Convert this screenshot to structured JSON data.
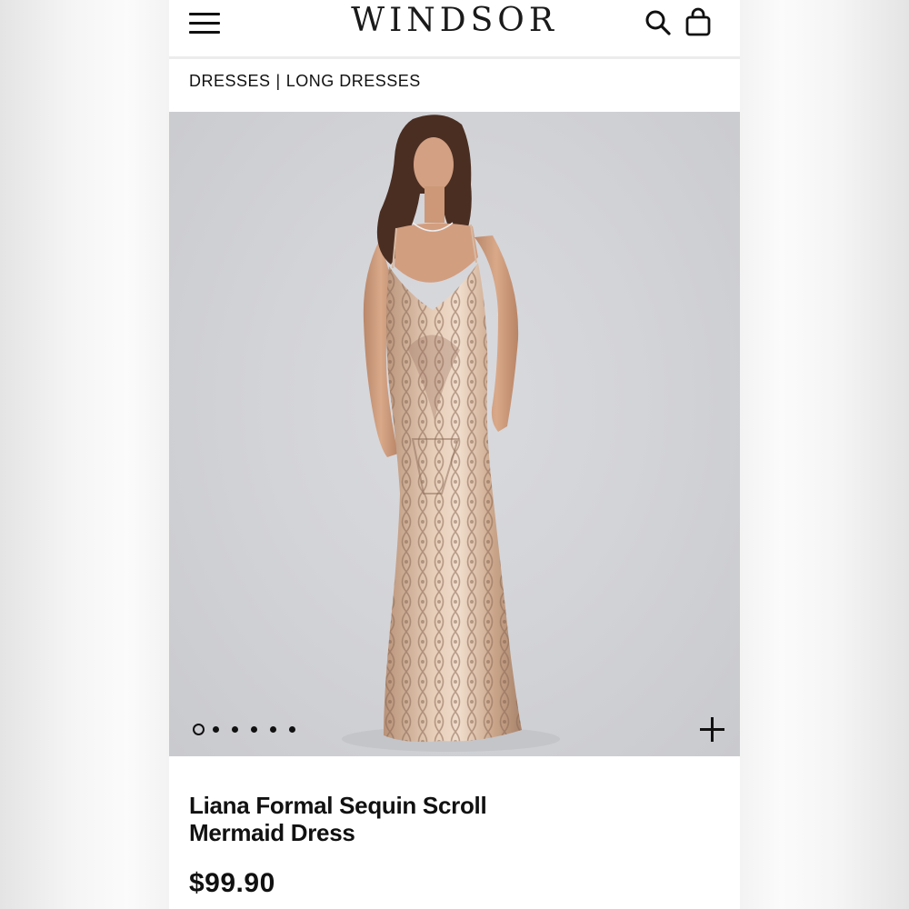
{
  "header": {
    "logo": "WINDSOR",
    "menu_icon": "hamburger-menu-icon",
    "search_icon": "search-icon",
    "bag_icon": "shopping-bag-icon"
  },
  "breadcrumb": {
    "items": [
      "DRESSES",
      "LONG DRESSES"
    ],
    "separator": "|"
  },
  "gallery": {
    "image_count": 6,
    "current_index": 1,
    "zoom_icon": "plus-icon"
  },
  "product": {
    "title": "Liana Formal Sequin Scroll Mermaid Dress",
    "price": "$99.90"
  },
  "colors": {
    "text": "#111111",
    "gallery_bg": "#d3d4d8",
    "dress": "#d8b8a0"
  }
}
